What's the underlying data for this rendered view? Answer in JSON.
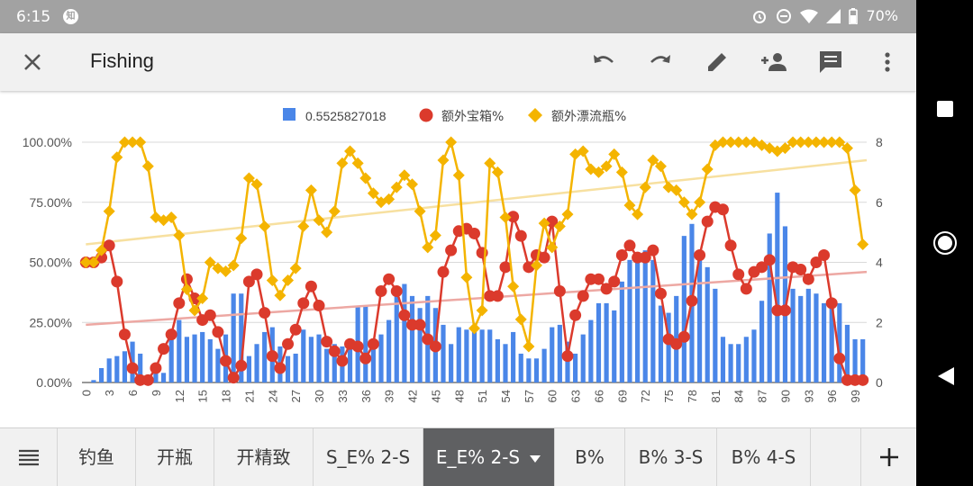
{
  "status_bar": {
    "time": "6:15",
    "app_badge": "知",
    "battery": "70%"
  },
  "toolbar": {
    "title": "Fishing",
    "icons": [
      "close-icon",
      "undo-icon",
      "redo-icon",
      "edit-icon",
      "add-person-icon",
      "comment-icon",
      "more-vert-icon"
    ]
  },
  "tabs": {
    "items": [
      "钓鱼",
      "开瓶",
      "开精致",
      "S_E% 2-S",
      "E_E% 2-S",
      "B%",
      "B% 3-S",
      "B% 4-S"
    ],
    "active_index": 4
  },
  "colors": {
    "bars": "#4a86e8",
    "red": "#db3a2c",
    "yellow": "#f4b400",
    "red_trend": "#eda8a3",
    "yellow_trend": "#f7e0a0"
  },
  "chart_data": {
    "type": "combo",
    "legend_position": "top",
    "x_ticks": [
      "0",
      "3",
      "6",
      "9",
      "12",
      "15",
      "18",
      "21",
      "24",
      "27",
      "30",
      "33",
      "36",
      "39",
      "42",
      "45",
      "48",
      "51",
      "54",
      "57",
      "60",
      "63",
      "66",
      "69",
      "72",
      "75",
      "78",
      "81",
      "84",
      "87",
      "90",
      "93",
      "96",
      "99"
    ],
    "left_axis": {
      "ticks": [
        "100.00%",
        "75.00%",
        "50.00%",
        "25.00%",
        "0.00%"
      ],
      "range": [
        0,
        100
      ]
    },
    "right_axis": {
      "ticks": [
        "8",
        "6",
        "4",
        "2",
        "0"
      ],
      "range": [
        0,
        8
      ]
    },
    "series": [
      {
        "name": "0.5525827018",
        "type": "bar",
        "axis": "left",
        "values": [
          0,
          1,
          6,
          10,
          11,
          13,
          17,
          12,
          1,
          5,
          4,
          22,
          26,
          19,
          20,
          21,
          18,
          14,
          20,
          37,
          37,
          11,
          16,
          21,
          23,
          15,
          11,
          12,
          22,
          19,
          20,
          14,
          16,
          15,
          18,
          32,
          32,
          18,
          20,
          26,
          40,
          41,
          36,
          31,
          36,
          31,
          24,
          16,
          23,
          22,
          22,
          22,
          22,
          18,
          16,
          21,
          12,
          10,
          10,
          14,
          23,
          24,
          17,
          12,
          20,
          26,
          33,
          33,
          30,
          42,
          51,
          54,
          55,
          51,
          32,
          29,
          36,
          61,
          66,
          55,
          48,
          39,
          19,
          16,
          16,
          19,
          22,
          34,
          62,
          79,
          65,
          39,
          36,
          39,
          37,
          33,
          33,
          33,
          24,
          18,
          18
        ]
      },
      {
        "name": "额外宝箱%",
        "type": "line",
        "axis": "left",
        "marker": "circle",
        "values": [
          50,
          50,
          52,
          57,
          42,
          20,
          6,
          1,
          1,
          6,
          14,
          20,
          33,
          43,
          35,
          26,
          28,
          21,
          9,
          2,
          7,
          42,
          45,
          29,
          11,
          6,
          16,
          22,
          33,
          40,
          32,
          17,
          13,
          9,
          16,
          15,
          10,
          16,
          38,
          43,
          38,
          28,
          24,
          24,
          18,
          15,
          46,
          55,
          63,
          64,
          62,
          54,
          36,
          36,
          48,
          69,
          61,
          48,
          53,
          52,
          67,
          38,
          11,
          28,
          36,
          43,
          43,
          39,
          42,
          53,
          57,
          52,
          52,
          55,
          37,
          18,
          16,
          19,
          34,
          53,
          67,
          73,
          72,
          57,
          45,
          39,
          46,
          48,
          51,
          30,
          30,
          48,
          47,
          43,
          50,
          53,
          33,
          10,
          1,
          1,
          1
        ]
      },
      {
        "name": "额外漂流瓶%",
        "type": "line",
        "axis": "right",
        "marker": "diamond",
        "values": [
          4.0,
          4.0,
          4.4,
          5.7,
          7.5,
          8.0,
          8.0,
          8.0,
          7.2,
          5.5,
          5.4,
          5.5,
          4.9,
          3.1,
          2.4,
          2.8,
          4.0,
          3.8,
          3.7,
          3.9,
          4.8,
          6.8,
          6.6,
          5.2,
          3.4,
          2.9,
          3.4,
          3.8,
          5.2,
          6.4,
          5.4,
          5.0,
          5.7,
          7.3,
          7.7,
          7.3,
          6.8,
          6.3,
          6.0,
          6.1,
          6.5,
          6.9,
          6.6,
          5.7,
          4.5,
          4.9,
          7.4,
          8.0,
          6.9,
          3.5,
          1.8,
          2.4,
          7.3,
          7.0,
          5.5,
          3.2,
          2.1,
          1.2,
          3.9,
          5.3,
          4.5,
          5.2,
          5.6,
          7.6,
          7.7,
          7.1,
          7.0,
          7.2,
          7.6,
          7.0,
          5.9,
          5.6,
          6.5,
          7.4,
          7.2,
          6.5,
          6.4,
          6.0,
          5.6,
          6.0,
          7.1,
          7.9,
          8.0,
          8.0,
          8.0,
          8.0,
          8.0,
          7.9,
          7.8,
          7.7,
          7.8,
          8.0,
          8.0,
          8.0,
          8.0,
          8.0,
          8.0,
          8.0,
          7.8,
          6.4,
          4.6
        ]
      }
    ],
    "trendlines": [
      {
        "series": "额外宝箱%",
        "start": 24,
        "end": 46
      },
      {
        "series": "额外漂流瓶%",
        "start": 4.6,
        "end": 7.4
      }
    ]
  }
}
